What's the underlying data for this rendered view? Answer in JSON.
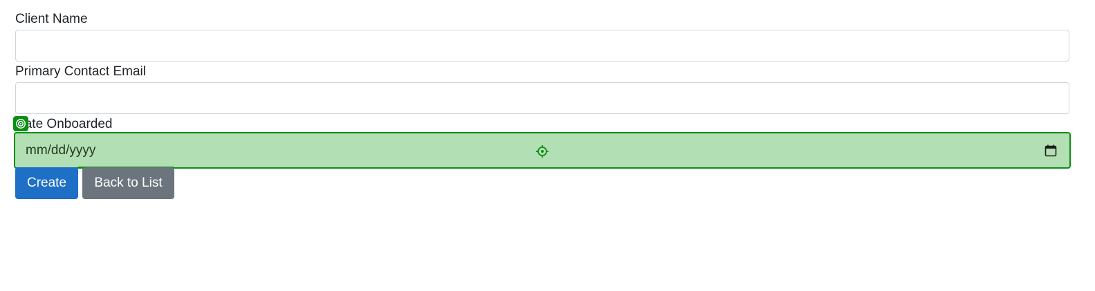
{
  "form": {
    "client_name": {
      "label": "Client Name",
      "value": "",
      "placeholder": ""
    },
    "primary_contact_email": {
      "label": "Primary Contact Email",
      "value": "",
      "placeholder": ""
    },
    "date_onboarded": {
      "label": "Date Onboarded",
      "display": "mm/dd/yyyy"
    }
  },
  "actions": {
    "create_label": "Create",
    "back_label": "Back to List"
  },
  "icons": {
    "calendar": "calendar-icon",
    "crosshair": "crosshair-icon",
    "target": "target-icon"
  },
  "colors": {
    "primary": "#1e6fc6",
    "secondary": "#6c757d",
    "highlight_fill": "#b3dfb4",
    "highlight_border": "#0a8f12"
  }
}
